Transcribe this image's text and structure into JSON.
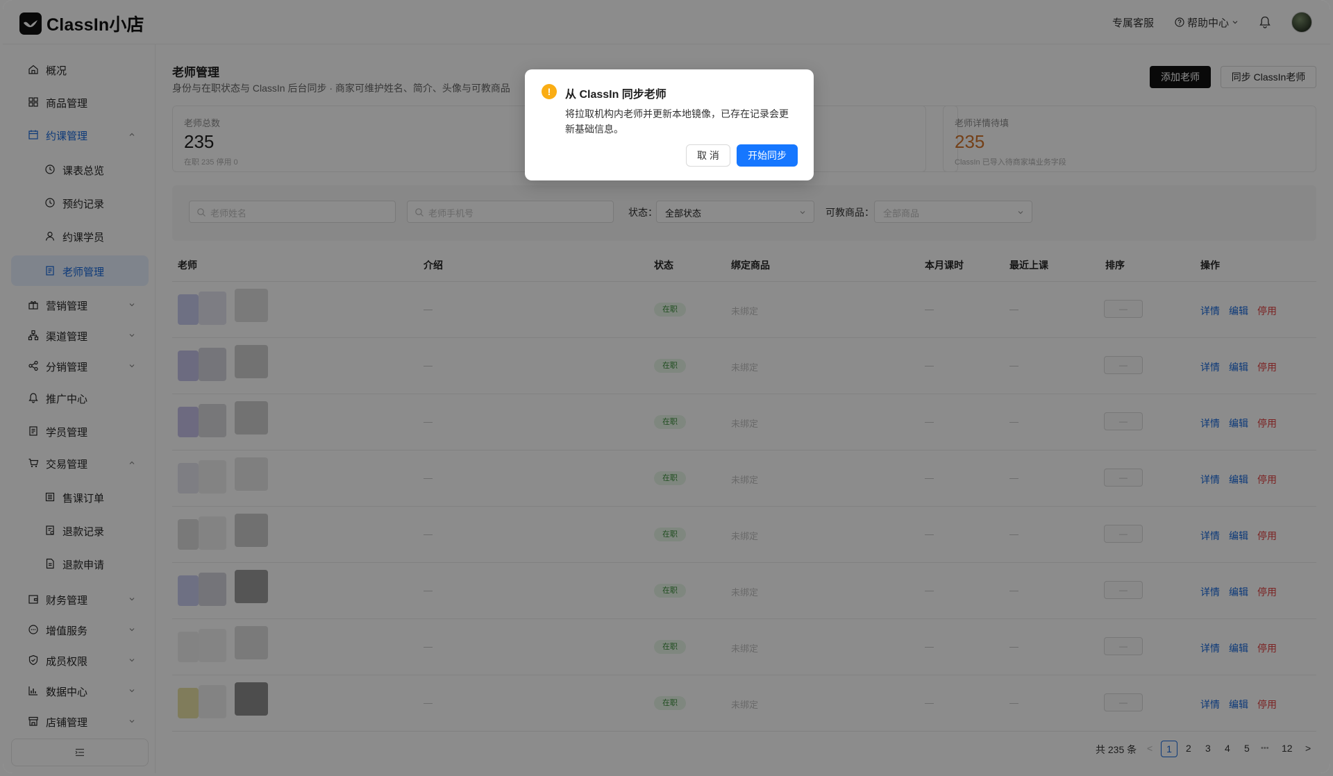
{
  "app": {
    "title": "ClassIn小店"
  },
  "header": {
    "support": "专属客服",
    "help": "帮助中心"
  },
  "sidebar": {
    "items": [
      {
        "label": "概况",
        "icon": "home-icon"
      },
      {
        "label": "商品管理",
        "icon": "grid-icon"
      },
      {
        "label": "约课管理",
        "icon": "calendar-icon",
        "state": "open"
      },
      {
        "label": "课表总览",
        "icon": "clock-icon",
        "sub": true
      },
      {
        "label": "预约记录",
        "icon": "clock-icon",
        "sub": true
      },
      {
        "label": "约课学员",
        "icon": "user-icon",
        "sub": true
      },
      {
        "label": "老师管理",
        "icon": "document-icon",
        "sub": true,
        "state": "active"
      },
      {
        "label": "营销管理",
        "icon": "gift-icon"
      },
      {
        "label": "渠道管理",
        "icon": "sitemap-icon"
      },
      {
        "label": "分销管理",
        "icon": "share-icon"
      },
      {
        "label": "推广中心",
        "icon": "bell-icon"
      },
      {
        "label": "学员管理",
        "icon": "document-icon"
      },
      {
        "label": "交易管理",
        "icon": "cart-icon",
        "state": "open"
      },
      {
        "label": "售课订单",
        "icon": "list-icon",
        "sub": true
      },
      {
        "label": "退款记录",
        "icon": "document-icon",
        "sub": true
      },
      {
        "label": "退款申请",
        "icon": "file-icon",
        "sub": true
      },
      {
        "label": "财务管理",
        "icon": "wallet-icon"
      },
      {
        "label": "增值服务",
        "icon": "chat-icon"
      },
      {
        "label": "成员权限",
        "icon": "shield-icon"
      },
      {
        "label": "数据中心",
        "icon": "bar-chart-icon"
      },
      {
        "label": "店铺管理",
        "icon": "store-icon"
      }
    ]
  },
  "page": {
    "title": "老师管理",
    "desc": "身份与在职状态与 ClassIn 后台同步 · 商家可维护姓名、简介、头像与可教商品",
    "add_button": "添加老师",
    "sync_button": "同步 ClassIn老师"
  },
  "stats": [
    {
      "title": "老师总数",
      "value": "235",
      "sub": "在职 235    停用 0"
    },
    {
      "title": "老师详情待填",
      "value": "235",
      "sub": "ClassIn 已导入待商家填业务字段",
      "color": "#d4762c"
    }
  ],
  "filters": {
    "name_placeholder": "老师姓名",
    "phone_placeholder": "老师手机号",
    "status_label": "状态：",
    "status_value": "全部状态",
    "product_label": "可教商品：",
    "product_value": "全部商品"
  },
  "table": {
    "columns": [
      "老师",
      "介绍",
      "状态",
      "绑定商品",
      "本月课时",
      "最近上课",
      "排序",
      "操作"
    ],
    "row_values": {
      "intro": "—",
      "status": "在职",
      "bound": "未绑定",
      "hours": "—",
      "last": "—",
      "sort": "—"
    },
    "actions": {
      "detail": "详情",
      "edit": "编辑",
      "disable": "停用"
    }
  },
  "pagination": {
    "total": "共 235 条",
    "pages": [
      "1",
      "2",
      "3",
      "4",
      "5"
    ],
    "ellipsis": "•••",
    "last": "12",
    "prev": "<",
    "next": ">"
  },
  "modal": {
    "title": "从 ClassIn 同步老师",
    "body": "将拉取机构内老师并更新本地镜像，已存在记录会更新基础信息。",
    "cancel": "取 消",
    "ok": "开始同步"
  },
  "colors": {
    "primary": "#1677ff",
    "danger": "#e04040",
    "warning": "#faad14",
    "success_bg": "#e7f6e7"
  }
}
